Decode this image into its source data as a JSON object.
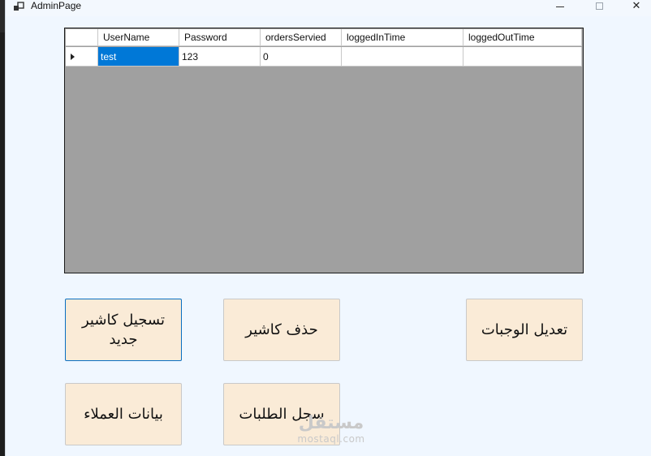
{
  "window": {
    "title": "AdminPage",
    "icon": "app-window-icon",
    "controls": [
      "minimize-icon",
      "maximize-icon",
      "close-icon"
    ],
    "close_glyph": "✕"
  },
  "grid": {
    "columns": [
      "",
      "UserName",
      "Password",
      "ordersServied",
      "loggedInTime",
      "loggedOutTime"
    ],
    "rows": [
      {
        "UserName": "test",
        "Password": "123",
        "ordersServied": "0",
        "loggedInTime": "",
        "loggedOutTime": ""
      }
    ],
    "selected_cell": "UserName",
    "colors": {
      "selection": "#0078d7",
      "empty_area": "#a0a0a0"
    }
  },
  "buttons": {
    "register_cashier": "تسجيل كاشير جديد",
    "delete_cashier": "حذف كاشير",
    "edit_meals": "تعديل الوجبات",
    "customer_data": "بيانات العملاء",
    "orders_log": "سجل الطلبات",
    "color": "#faebd7"
  },
  "watermark": {
    "arabic": "مستقل",
    "latin": "mostaql.com"
  }
}
